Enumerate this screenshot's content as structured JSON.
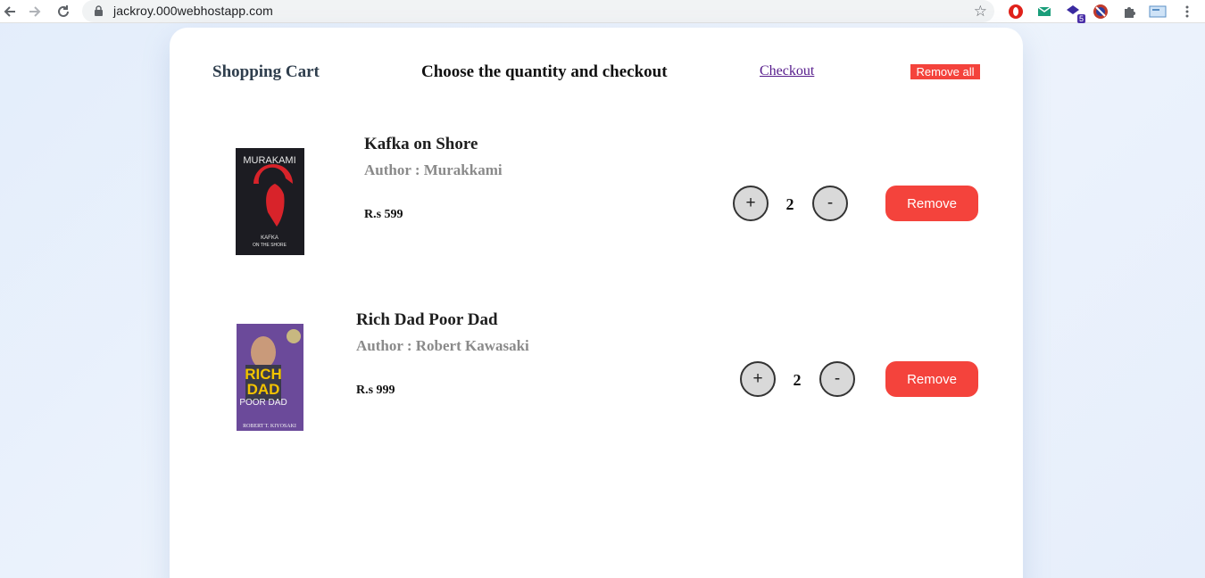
{
  "browser": {
    "url": "jackroy.000webhostapp.com",
    "extension_badge": "5"
  },
  "header": {
    "title": "Shopping Cart",
    "subtitle": "Choose the quantity and checkout",
    "checkout_label": "Checkout",
    "remove_all_label": "Remove all"
  },
  "items": [
    {
      "title": "Kafka on Shore",
      "author": "Author : Murakkami",
      "price": "R.s 599",
      "quantity": "2",
      "plus_label": "+",
      "minus_label": "-",
      "remove_label": "Remove",
      "cover_top_text": "MURAKAMI",
      "cover_bottom_text": "KAFKA",
      "cover_bottom_text2": "ON THE SHORE"
    },
    {
      "title": "Rich Dad Poor Dad",
      "author": "Author : Robert Kawasaki",
      "price": "R.s 999",
      "quantity": "2",
      "plus_label": "+",
      "minus_label": "-",
      "remove_label": "Remove",
      "cover_word1": "RICH",
      "cover_word2": "DAD",
      "cover_word3": "POOR DAD",
      "cover_author": "ROBERT T. KIYOSAKI"
    }
  ],
  "colors": {
    "accent_red": "#f4433c",
    "link_purple": "#551a8b"
  }
}
